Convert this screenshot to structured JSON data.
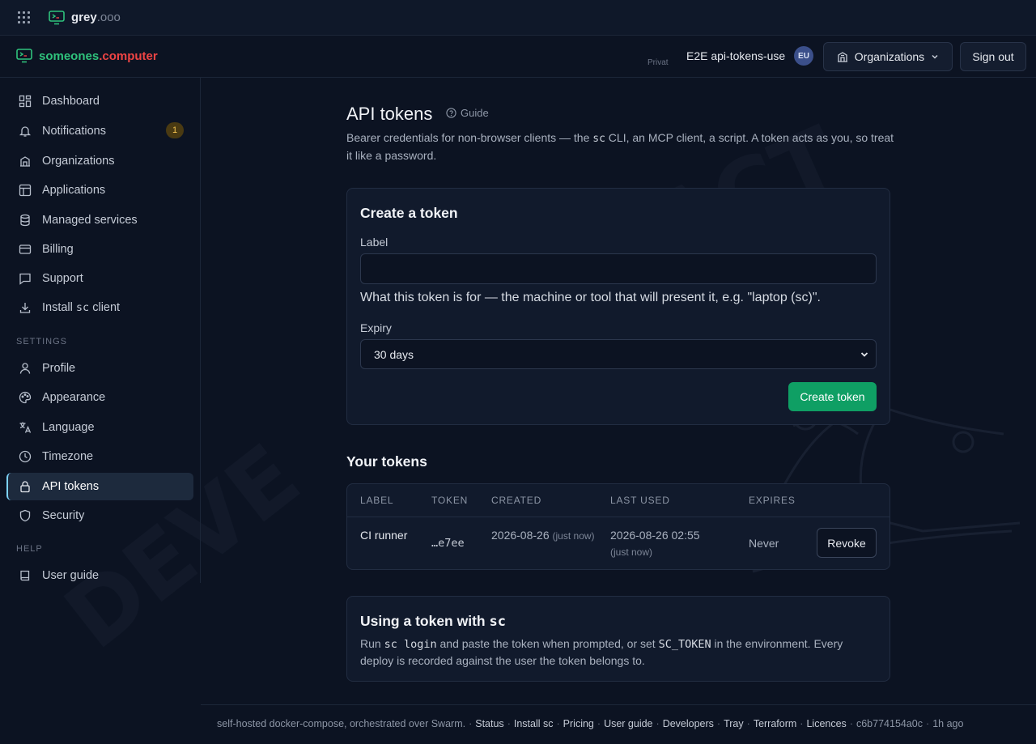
{
  "topbar": {
    "brand": "grey",
    "brand_suffix": ".ooo"
  },
  "header": {
    "logo_main": "someones",
    "logo_suffix": ".computer",
    "private_tag": "Privat",
    "user_name": "E2E api-tokens-use",
    "region": "EU",
    "organizations_label": "Organizations",
    "sign_out_label": "Sign out"
  },
  "sidebar": {
    "items": [
      {
        "label": "Dashboard",
        "icon": "dashboard-icon"
      },
      {
        "label": "Notifications",
        "icon": "bell-icon",
        "badge": "1"
      },
      {
        "label": "Organizations",
        "icon": "building-icon"
      },
      {
        "label": "Applications",
        "icon": "layout-icon"
      },
      {
        "label": "Managed services",
        "icon": "database-icon"
      },
      {
        "label": "Billing",
        "icon": "credit-card-icon"
      },
      {
        "label": "Support",
        "icon": "chat-icon"
      },
      {
        "label_prefix": "Install ",
        "label_code": "sc",
        "label_suffix": " client",
        "icon": "download-icon"
      }
    ],
    "settings_label": "SETTINGS",
    "settings": [
      {
        "label": "Profile",
        "icon": "user-icon"
      },
      {
        "label": "Appearance",
        "icon": "palette-icon"
      },
      {
        "label": "Language",
        "icon": "translate-icon"
      },
      {
        "label": "Timezone",
        "icon": "clock-icon"
      },
      {
        "label": "API tokens",
        "icon": "lock-icon",
        "active": true
      },
      {
        "label": "Security",
        "icon": "shield-icon"
      }
    ],
    "help_label": "HELP",
    "help": [
      {
        "label": "User guide",
        "icon": "book-icon"
      }
    ]
  },
  "page": {
    "title": "API tokens",
    "guide_label": "Guide",
    "desc_1": "Bearer credentials for non-browser clients — the ",
    "desc_code": "sc",
    "desc_2": " CLI, an MCP client, a script. A token acts as you, so treat it like a password."
  },
  "create": {
    "title": "Create a token",
    "label_field": "Label",
    "label_value": "",
    "label_placeholder": "",
    "label_help": "What this token is for — the machine or tool that will present it, e.g. \"laptop (sc)\".",
    "expiry_field": "Expiry",
    "expiry_value": "30 days",
    "submit_label": "Create token"
  },
  "tokens": {
    "title": "Your tokens",
    "columns": [
      "LABEL",
      "TOKEN",
      "CREATED",
      "LAST USED",
      "EXPIRES"
    ],
    "rows": [
      {
        "label": "CI runner",
        "token": "…e7ee",
        "created": "2026-08-26",
        "created_rel": "(just now)",
        "last_used": "2026-08-26 02:55",
        "last_used_rel": "(just now)",
        "expires": "Never",
        "action": "Revoke"
      }
    ]
  },
  "usage": {
    "title_text": "Using a token with ",
    "title_code": "sc",
    "text_1": "Run ",
    "code_1": "sc login",
    "text_2": " and paste the token when prompted, or set ",
    "code_2": "SC_TOKEN",
    "text_3": " in the environment. Every deploy is recorded against the user the token belongs to."
  },
  "footer": {
    "prefix": "self-hosted docker-compose, orchestrated over Swarm.",
    "links": [
      "Status",
      "Install sc",
      "Pricing",
      "User guide",
      "Developers",
      "Tray",
      "Terraform",
      "Licences"
    ],
    "commit": "c6b774154a0c",
    "age": "1h ago"
  },
  "colors": {
    "accent_green": "#0f9f64",
    "logo_green": "#2fc27c",
    "logo_red": "#ef4444",
    "active_border": "#7dd3fc"
  }
}
